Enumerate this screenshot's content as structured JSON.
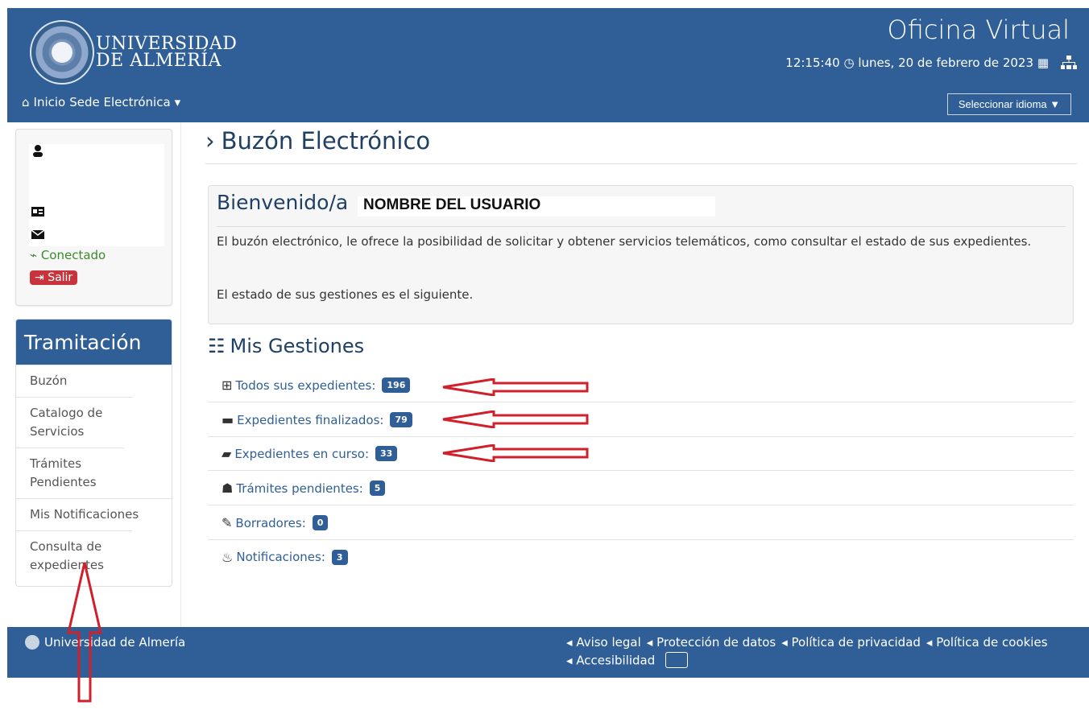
{
  "header": {
    "university_name": [
      "UNIVERSIDAD",
      "DE ALMERÍA"
    ],
    "office_title": "Oficina Virtual",
    "time": "12:15:40",
    "date": "lunes, 20 de febrero de 2023",
    "nav_home": "Inicio",
    "nav_sede": "Sede Electrónica",
    "language_select": "Seleccionar idioma"
  },
  "sidebar": {
    "status": "Conectado",
    "logout": "Salir",
    "menu_title": "Tramitación",
    "items": [
      "Buzón",
      "Catalogo de Servicios",
      "Trámites Pendientes",
      "Mis Notificaciones",
      "Consulta de expedientes"
    ]
  },
  "main": {
    "title": "Buzón Electrónico",
    "welcome_title": "Bienvenido/a",
    "username": "NOMBRE DEL USUARIO",
    "intro": "El buzón electrónico, le ofrece la posibilidad de solicitar y obtener servicios telemáticos, como consultar el estado de sus expedientes.",
    "status_line": "El estado de sus gestiones es el siguiente.",
    "gestiones_title": "Mis Gestiones",
    "gestiones": [
      {
        "label": "Todos sus expedientes:",
        "count": "196"
      },
      {
        "label": "Expedientes finalizados:",
        "count": "79"
      },
      {
        "label": "Expedientes en curso:",
        "count": "33"
      },
      {
        "label": "Trámites pendientes:",
        "count": "5"
      },
      {
        "label": "Borradores:",
        "count": "0"
      },
      {
        "label": "Notificaciones:",
        "count": "3"
      }
    ]
  },
  "footer": {
    "university": "Universidad de Almería",
    "links": [
      "Aviso legal",
      "Protección de datos",
      "Política de privacidad",
      "Política de cookies",
      "Accesibilidad"
    ]
  },
  "colors": {
    "primary": "#2f5f96",
    "danger": "#c7343b",
    "success": "#3a8a2a",
    "annotation_arrow": "#d0202b"
  }
}
